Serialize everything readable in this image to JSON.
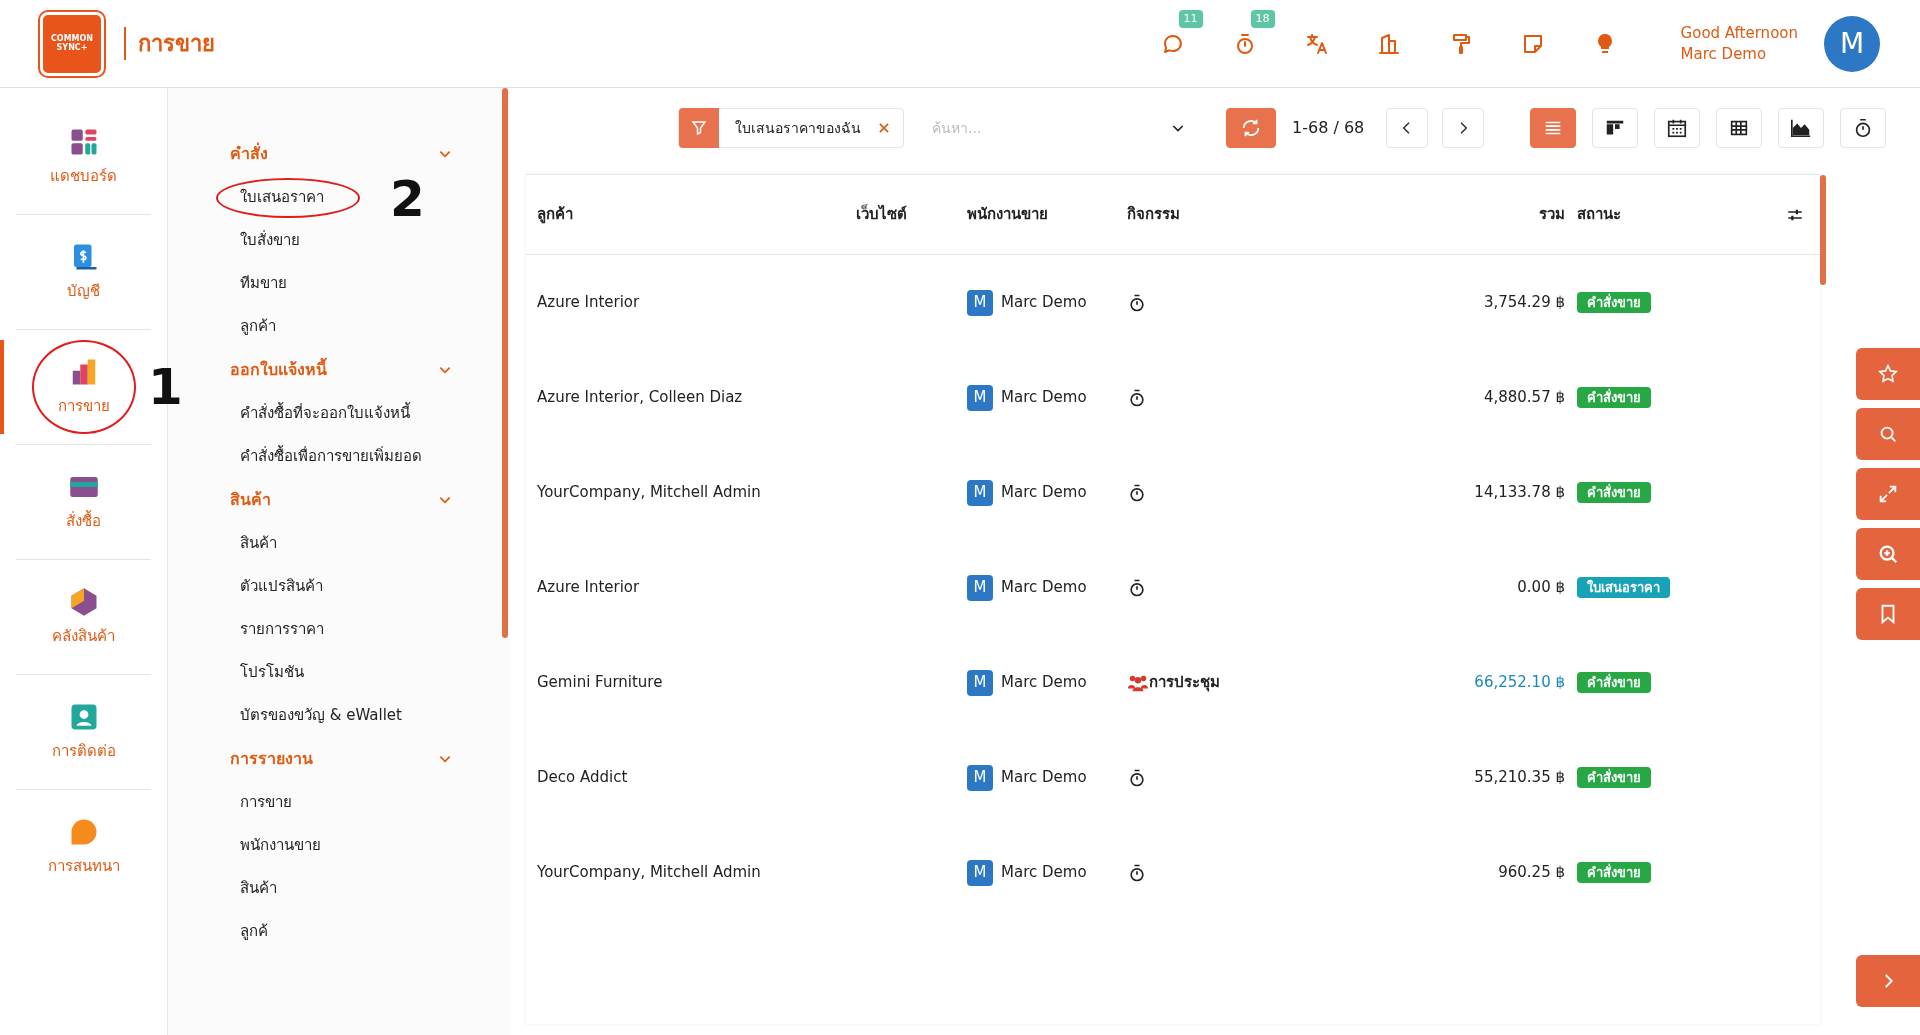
{
  "header": {
    "logo_text": "COMMON SYNC+",
    "app_title": "การขาย",
    "icons": [
      {
        "kind": "chat",
        "badge": "11"
      },
      {
        "kind": "timer",
        "badge": "18"
      },
      {
        "kind": "translate"
      },
      {
        "kind": "building"
      },
      {
        "kind": "roller"
      },
      {
        "kind": "note"
      },
      {
        "kind": "bulb"
      }
    ],
    "greeting": "Good Afternoon",
    "user_name": "Marc Demo",
    "avatar": "M"
  },
  "apps": [
    {
      "label": "แดชบอร์ด",
      "kind": "dashboard",
      "selected": false
    },
    {
      "label": "บัญชี",
      "kind": "invoice",
      "selected": false
    },
    {
      "label": "การขาย",
      "kind": "sales",
      "selected": true,
      "annotation": "1"
    },
    {
      "label": "สั่งซื้อ",
      "kind": "card",
      "selected": false
    },
    {
      "label": "คลังสินค้า",
      "kind": "box",
      "selected": false
    },
    {
      "label": "การติดต่อ",
      "kind": "contact",
      "selected": false
    },
    {
      "label": "การสนทนา",
      "kind": "chat",
      "selected": false
    }
  ],
  "menu": [
    {
      "title": "คำสั่ง",
      "expanded": true,
      "items": [
        {
          "label": "ใบเสนอราคา",
          "annotation": "2"
        },
        {
          "label": "ใบสั่งขาย"
        },
        {
          "label": "ทีมขาย"
        },
        {
          "label": "ลูกค้า"
        }
      ]
    },
    {
      "title": "ออกใบแจ้งหนี้",
      "expanded": true,
      "items": [
        {
          "label": "คำสั่งซื้อที่จะออกใบแจ้งหนี้"
        },
        {
          "label": "คำสั่งซื้อเพื่อการขายเพิ่มยอด"
        }
      ]
    },
    {
      "title": "สินค้า",
      "expanded": true,
      "items": [
        {
          "label": "สินค้า"
        },
        {
          "label": "ตัวแปรสินค้า"
        },
        {
          "label": "รายการราคา"
        },
        {
          "label": "โปรโมชัน"
        },
        {
          "label": "บัตรของขวัญ & eWallet"
        }
      ]
    },
    {
      "title": "การรายงาน",
      "expanded": true,
      "items": [
        {
          "label": "การขาย"
        },
        {
          "label": "พนักงานขาย"
        },
        {
          "label": "สินค้า"
        },
        {
          "label": "ลูกค้"
        }
      ]
    }
  ],
  "toolbar": {
    "filter": "ใบเสนอราคาของฉัน",
    "search_placeholder": "ค้นหา...",
    "pager": "1-68 / 68",
    "views": [
      {
        "kind": "list",
        "selected": true
      },
      {
        "kind": "kanban",
        "selected": false
      },
      {
        "kind": "calendar",
        "selected": false
      },
      {
        "kind": "pivot",
        "selected": false
      },
      {
        "kind": "graph",
        "selected": false
      },
      {
        "kind": "activity",
        "selected": false
      }
    ]
  },
  "table": {
    "columns": [
      "ลูกค้า",
      "เว็บไซต์",
      "พนักงานขาย",
      "กิจกรรม",
      "รวม",
      "สถานะ"
    ],
    "rows": [
      {
        "customer": "Azure Interior",
        "salesperson": "Marc Demo",
        "avatar": "M",
        "activity": {
          "kind": "clock"
        },
        "total": "3,754.29 ฿",
        "highlighted": false,
        "status": {
          "kind": "order",
          "label": "คำสั่งขาย"
        }
      },
      {
        "customer": "Azure Interior, Colleen Diaz",
        "salesperson": "Marc Demo",
        "avatar": "M",
        "activity": {
          "kind": "clock"
        },
        "total": "4,880.57 ฿",
        "highlighted": false,
        "status": {
          "kind": "order",
          "label": "คำสั่งขาย"
        }
      },
      {
        "customer": "YourCompany, Mitchell Admin",
        "salesperson": "Marc Demo",
        "avatar": "M",
        "activity": {
          "kind": "clock"
        },
        "total": "14,133.78 ฿",
        "highlighted": false,
        "status": {
          "kind": "order",
          "label": "คำสั่งขาย"
        }
      },
      {
        "customer": "Azure Interior",
        "salesperson": "Marc Demo",
        "avatar": "M",
        "activity": {
          "kind": "clock"
        },
        "total": "0.00 ฿",
        "highlighted": false,
        "status": {
          "kind": "quotation",
          "label": "ใบเสนอราคา"
        }
      },
      {
        "customer": "Gemini Furniture",
        "salesperson": "Marc Demo",
        "avatar": "M",
        "activity": {
          "kind": "meeting",
          "label": "การประชุม"
        },
        "total": "66,252.10 ฿",
        "highlighted": true,
        "status": {
          "kind": "order",
          "label": "คำสั่งขาย"
        }
      },
      {
        "customer": "Deco Addict",
        "salesperson": "Marc Demo",
        "avatar": "M",
        "activity": {
          "kind": "clock"
        },
        "total": "55,210.35 ฿",
        "highlighted": false,
        "status": {
          "kind": "order",
          "label": "คำสั่งขาย"
        }
      },
      {
        "customer": "YourCompany, Mitchell Admin",
        "salesperson": "Marc Demo",
        "avatar": "M",
        "activity": {
          "kind": "clock"
        },
        "total": "960.25 ฿",
        "highlighted": false,
        "status": {
          "kind": "order",
          "label": "คำสั่งขาย"
        }
      }
    ]
  },
  "side_buttons": [
    {
      "kind": "star"
    },
    {
      "kind": "search"
    },
    {
      "kind": "expand"
    },
    {
      "kind": "zoom"
    },
    {
      "kind": "bookmark"
    }
  ]
}
